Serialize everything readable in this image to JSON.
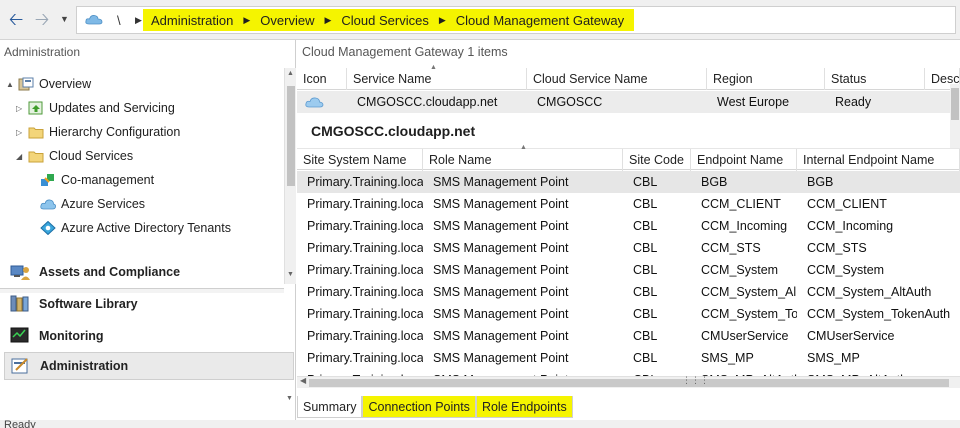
{
  "address": {
    "root_sep": "\\",
    "crumbs": [
      "Administration",
      "Overview",
      "Cloud Services",
      "Cloud Management Gateway"
    ]
  },
  "nav": {
    "title": "Administration",
    "tree": [
      {
        "label": "Overview",
        "icon": "overview-icon",
        "twisty": "▲"
      },
      {
        "label": "Updates and Servicing",
        "icon": "updates-icon",
        "twisty": "▷"
      },
      {
        "label": "Hierarchy Configuration",
        "icon": "folder-icon",
        "twisty": "▷"
      },
      {
        "label": "Cloud Services",
        "icon": "folder-icon",
        "twisty": "◢"
      },
      {
        "label": "Co-management",
        "icon": "co-management-icon",
        "twisty": ""
      },
      {
        "label": "Azure Services",
        "icon": "cloud-icon",
        "twisty": ""
      },
      {
        "label": "Azure Active Directory Tenants",
        "icon": "aad-icon",
        "twisty": ""
      }
    ],
    "workspaces": [
      {
        "label": "Assets and Compliance",
        "icon": "assets-icon"
      },
      {
        "label": "Software Library",
        "icon": "software-library-icon"
      },
      {
        "label": "Monitoring",
        "icon": "monitoring-icon"
      },
      {
        "label": "Administration",
        "icon": "administration-icon"
      }
    ]
  },
  "gateway_list": {
    "title": "Cloud Management Gateway 1 items",
    "columns": [
      "Icon",
      "Service Name",
      "Cloud Service Name",
      "Region",
      "Status",
      "Desc"
    ],
    "rows": [
      {
        "service_name": "CMGOSCC.cloudapp.net",
        "cloud_service_name": "CMGOSCC",
        "region": "West Europe",
        "status": "Ready"
      }
    ]
  },
  "details": {
    "heading": "CMGOSCC.cloudapp.net",
    "columns": [
      "Site System Name",
      "Role Name",
      "Site Code",
      "Endpoint Name",
      "Internal Endpoint Name"
    ],
    "rows": [
      [
        "Primary.Training.local",
        "SMS Management Point",
        "CBL",
        "BGB",
        "BGB"
      ],
      [
        "Primary.Training.local",
        "SMS Management Point",
        "CBL",
        "CCM_CLIENT",
        "CCM_CLIENT"
      ],
      [
        "Primary.Training.local",
        "SMS Management Point",
        "CBL",
        "CCM_Incoming",
        "CCM_Incoming"
      ],
      [
        "Primary.Training.local",
        "SMS Management Point",
        "CBL",
        "CCM_STS",
        "CCM_STS"
      ],
      [
        "Primary.Training.local",
        "SMS Management Point",
        "CBL",
        "CCM_System",
        "CCM_System"
      ],
      [
        "Primary.Training.local",
        "SMS Management Point",
        "CBL",
        "CCM_System_Al...",
        "CCM_System_AltAuth"
      ],
      [
        "Primary.Training.local",
        "SMS Management Point",
        "CBL",
        "CCM_System_To...",
        "CCM_System_TokenAuth"
      ],
      [
        "Primary.Training.local",
        "SMS Management Point",
        "CBL",
        "CMUserService",
        "CMUserService"
      ],
      [
        "Primary.Training.local",
        "SMS Management Point",
        "CBL",
        "SMS_MP",
        "SMS_MP"
      ],
      [
        "Primary.Training.local",
        "SMS Management Point",
        "CBL",
        "SMS_MP_AltAuth",
        "SMS_MP_AltAuth"
      ]
    ]
  },
  "tabs": [
    "Summary",
    "Connection Points",
    "Role Endpoints"
  ],
  "status_bar": "Ready",
  "colors": {
    "highlight": "#f5f400",
    "accent": "#2a5b9c"
  }
}
